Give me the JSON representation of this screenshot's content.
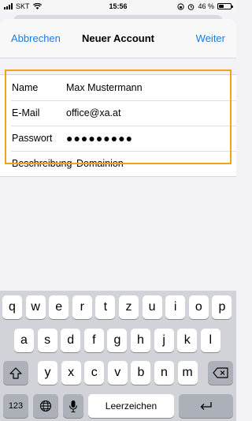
{
  "status": {
    "carrier": "SKT",
    "time": "15:56",
    "battery_percent": "46 %",
    "battery_level": 0.46
  },
  "nav": {
    "cancel_label": "Abbrechen",
    "title": "Neuer Account",
    "next_label": "Weiter"
  },
  "form": {
    "name_label": "Name",
    "name_value": "Max Mustermann",
    "email_label": "E-Mail",
    "email_value": "office@xa.at",
    "password_label": "Passwort",
    "password_value": "●●●●●●●●●",
    "description_label": "Beschreibung",
    "description_value": "Domainion"
  },
  "keyboard": {
    "row1": [
      "q",
      "w",
      "e",
      "r",
      "t",
      "z",
      "u",
      "i",
      "o",
      "p"
    ],
    "row2": [
      "a",
      "s",
      "d",
      "f",
      "g",
      "h",
      "j",
      "k",
      "l"
    ],
    "row3": [
      "y",
      "x",
      "c",
      "v",
      "b",
      "n",
      "m"
    ],
    "numbers_label": "123",
    "space_label": "Leerzeichen",
    "shift_icon": "shift-icon",
    "delete_icon": "delete-icon",
    "globe_icon": "globe-icon",
    "mic_icon": "microphone-icon",
    "return_icon": "return-icon"
  },
  "colors": {
    "accent": "#1a7be0",
    "highlight": "#f5a21b"
  }
}
